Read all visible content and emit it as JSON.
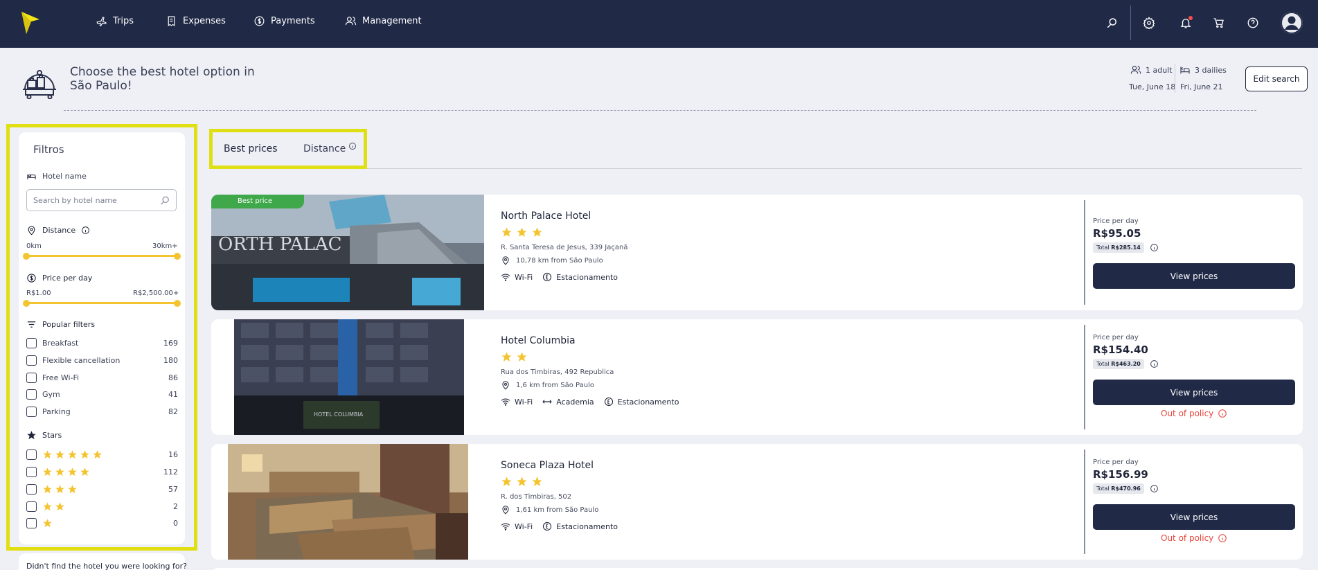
{
  "nav": {
    "items": [
      {
        "label": "Trips",
        "icon": "plane-icon"
      },
      {
        "label": "Expenses",
        "icon": "receipt-icon"
      },
      {
        "label": "Payments",
        "icon": "dollar-coin-icon"
      },
      {
        "label": "Management",
        "icon": "users-icon"
      }
    ],
    "right_icons": [
      "search-icon",
      "gear-icon",
      "bell-icon",
      "cart-icon",
      "help-icon"
    ]
  },
  "header": {
    "title": "Choose the best hotel option in São Paulo!",
    "adults": "1 adult",
    "dailies": "3 dailies",
    "checkin": "Tue, June 18",
    "checkout": "Fri, June 21",
    "edit_button": "Edit search"
  },
  "filters": {
    "title": "Filtros",
    "hotel_name_label": "Hotel name",
    "hotel_name_placeholder": "Search by hotel name",
    "hotel_name_value": "",
    "distance_label": "Distance",
    "distance_min": "0km",
    "distance_max": "30km+",
    "price_label": "Price per day",
    "price_min": "R$1.00",
    "price_max": "R$2,500.00+",
    "popular_label": "Popular filters",
    "popular": [
      {
        "label": "Breakfast",
        "count": "169"
      },
      {
        "label": "Flexible cancellation",
        "count": "180"
      },
      {
        "label": "Free Wi-Fi",
        "count": "86"
      },
      {
        "label": "Gym",
        "count": "41"
      },
      {
        "label": "Parking",
        "count": "82"
      }
    ],
    "stars_label": "Stars",
    "stars": [
      {
        "stars": 5,
        "count": "16"
      },
      {
        "stars": 4,
        "count": "112"
      },
      {
        "stars": 3,
        "count": "57"
      },
      {
        "stars": 2,
        "count": "2"
      },
      {
        "stars": 1,
        "count": "0"
      }
    ],
    "help_text": "Didn't find the hotel you were looking for?"
  },
  "tabs": {
    "active": "Best prices",
    "other": "Distance"
  },
  "colors": {
    "nav_bg": "#202a47",
    "highlight": "#e0df13",
    "star": "#f4c430",
    "badge": "#3ea84a",
    "out_of_policy": "#e5473d"
  },
  "hotels": [
    {
      "badge": "Best price",
      "name": "North Palace Hotel",
      "stars": 3,
      "address": "R. Santa Teresa de Jesus, 339 Jaçanã",
      "distance": "10,78 km from São Paulo",
      "amenities": [
        {
          "label": "Wi-Fi",
          "icon": "wifi-icon"
        },
        {
          "label": "Estacionamento",
          "icon": "parking-icon"
        }
      ],
      "price_label": "Price per day",
      "price": "R$95.05",
      "total_label": "Total",
      "total": "R$285.14",
      "button": "View prices",
      "policy": ""
    },
    {
      "badge": "",
      "name": "Hotel Columbia",
      "stars": 2,
      "address": "Rua dos Timbiras, 492 Republica",
      "distance": "1,6 km from São Paulo",
      "amenities": [
        {
          "label": "Wi-Fi",
          "icon": "wifi-icon"
        },
        {
          "label": "Academia",
          "icon": "gym-icon"
        },
        {
          "label": "Estacionamento",
          "icon": "parking-icon"
        }
      ],
      "price_label": "Price per day",
      "price": "R$154.40",
      "total_label": "Total",
      "total": "R$463.20",
      "button": "View prices",
      "policy": "Out of policy"
    },
    {
      "badge": "",
      "name": "Soneca Plaza Hotel",
      "stars": 3,
      "address": "R. dos Timbiras, 502",
      "distance": "1,61 km from São Paulo",
      "amenities": [
        {
          "label": "Wi-Fi",
          "icon": "wifi-icon"
        },
        {
          "label": "Estacionamento",
          "icon": "parking-icon"
        }
      ],
      "price_label": "Price per day",
      "price": "R$156.99",
      "total_label": "Total",
      "total": "R$470.96",
      "button": "View prices",
      "policy": "Out of policy"
    }
  ]
}
